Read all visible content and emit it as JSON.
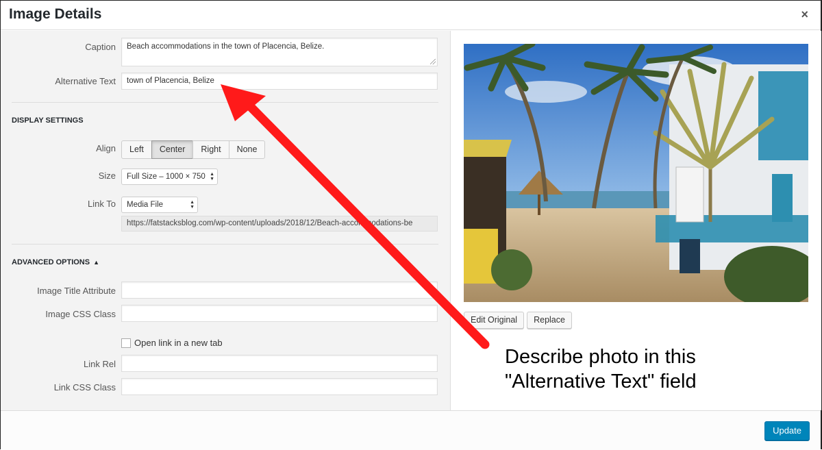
{
  "dialog": {
    "title": "Image Details",
    "close_icon": "×"
  },
  "form": {
    "caption": {
      "label": "Caption",
      "value": "Beach accommodations in the town of Placencia, Belize."
    },
    "alt_text": {
      "label": "Alternative Text",
      "value": "town of Placencia, Belize"
    },
    "display_settings": {
      "title": "DISPLAY SETTINGS",
      "align": {
        "label": "Align",
        "options": [
          "Left",
          "Center",
          "Right",
          "None"
        ],
        "selected": "Center"
      },
      "size": {
        "label": "Size",
        "value": "Full Size – 1000 × 750"
      },
      "link_to": {
        "label": "Link To",
        "value": "Media File",
        "url": "https://fatstacksblog.com/wp-content/uploads/2018/12/Beach-accommodations-be"
      }
    },
    "advanced_options": {
      "title": "ADVANCED OPTIONS",
      "toggle_icon": "▲",
      "image_title_attribute": {
        "label": "Image Title Attribute",
        "value": ""
      },
      "image_css_class": {
        "label": "Image CSS Class",
        "value": ""
      },
      "open_new_tab": {
        "label": "Open link in a new tab",
        "checked": false
      },
      "link_rel": {
        "label": "Link Rel",
        "value": ""
      },
      "link_css_class": {
        "label": "Link CSS Class",
        "value": ""
      }
    }
  },
  "preview": {
    "edit_original_label": "Edit Original",
    "replace_label": "Replace"
  },
  "footer": {
    "update_label": "Update"
  },
  "annotation": {
    "line1": "Describe photo in this",
    "line2": "\"Alternative Text\" field",
    "arrow_color": "#ff1a1a"
  },
  "colors": {
    "primary": "#0085ba",
    "arrow": "#ff1a1a"
  }
}
